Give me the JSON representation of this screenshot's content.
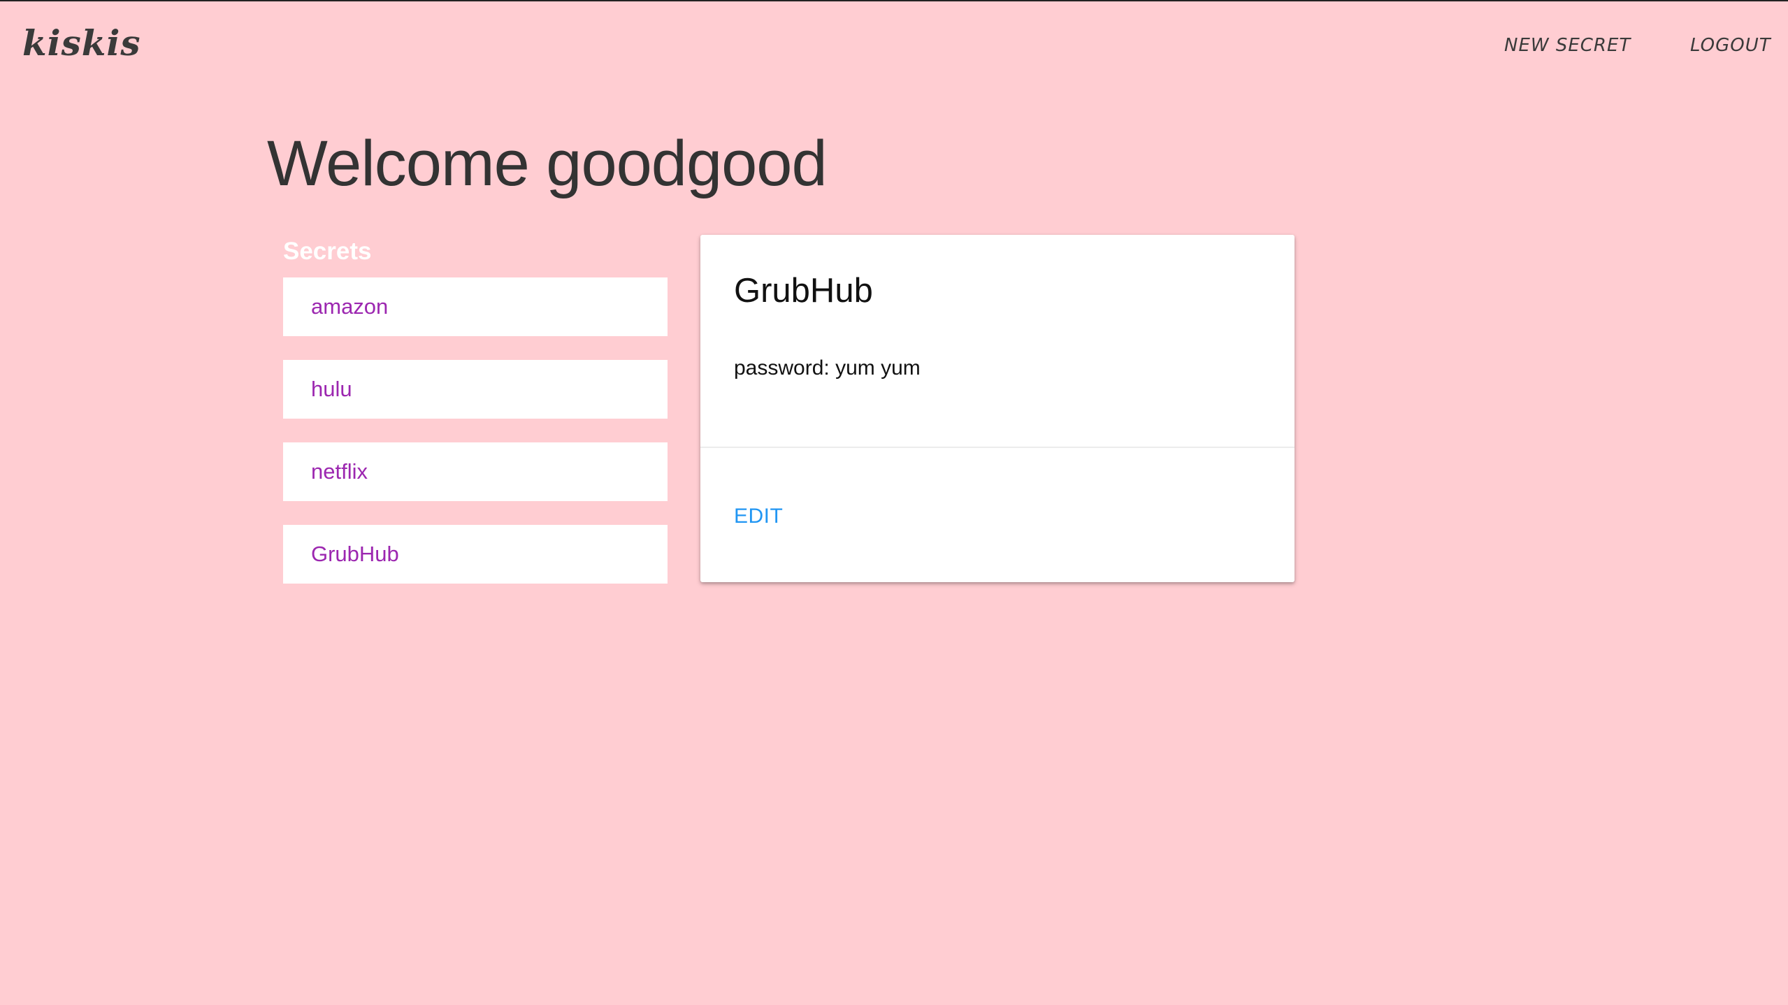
{
  "header": {
    "brand": "kiskis",
    "nav": {
      "new_secret": "NEW SECRET",
      "logout": "LOGOUT"
    }
  },
  "main": {
    "welcome": "Welcome goodgood",
    "secrets_heading": "Secrets",
    "secrets": [
      {
        "label": "amazon"
      },
      {
        "label": "hulu"
      },
      {
        "label": "netflix"
      },
      {
        "label": "GrubHub"
      }
    ],
    "detail": {
      "title": "GrubHub",
      "body": "password: yum yum",
      "action": "EDIT"
    }
  },
  "colors": {
    "background": "#ffcdd2",
    "link_purple": "#9c27b0",
    "action_blue": "#2196f3",
    "text_dark": "#333333"
  }
}
